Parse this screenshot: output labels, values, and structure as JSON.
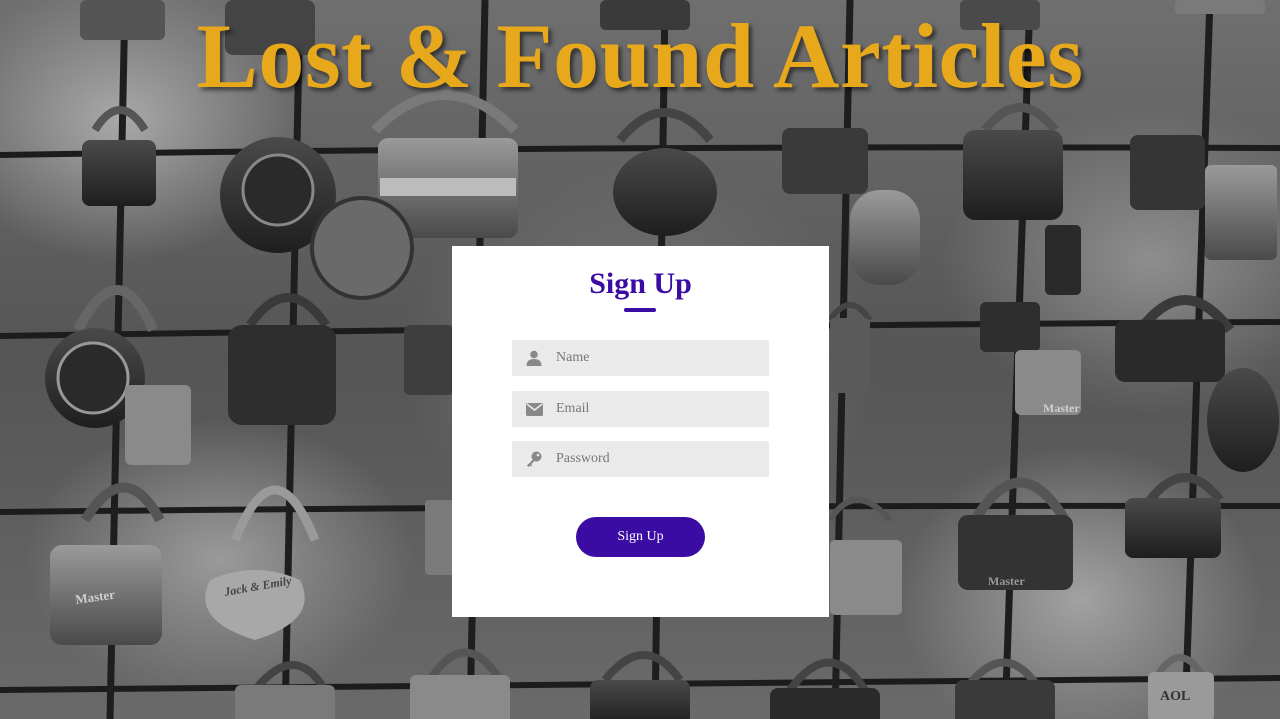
{
  "page": {
    "title": "Lost & Found Articles",
    "title_color": "#e8a81c"
  },
  "background": {
    "description_icon": "padlocks-on-fence-photo",
    "engraved_texts": [
      "Master",
      "Master",
      "Master",
      "Jack & Emily",
      "AOL"
    ]
  },
  "signup": {
    "heading": "Sign Up",
    "accent_color": "#3a0ca3",
    "fields": {
      "name": {
        "placeholder": "Name",
        "value": "",
        "icon": "user-icon"
      },
      "email": {
        "placeholder": "Email",
        "value": "",
        "icon": "envelope-icon"
      },
      "password": {
        "placeholder": "Password",
        "value": "",
        "icon": "key-icon"
      }
    },
    "submit_label": "Sign Up"
  }
}
